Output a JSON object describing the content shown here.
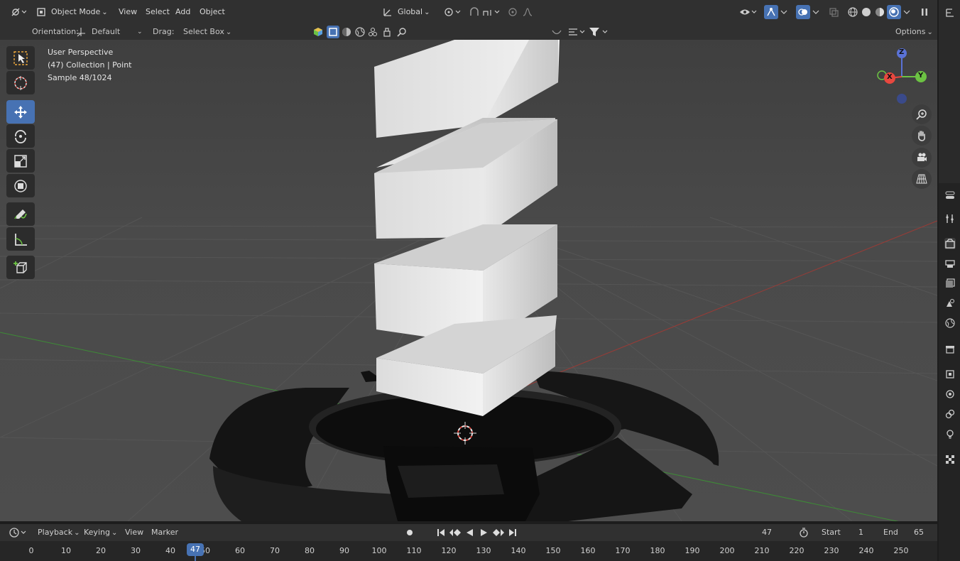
{
  "header": {
    "mode": "Object Mode",
    "menus": [
      "View",
      "Select",
      "Add",
      "Object"
    ],
    "transform_orientation": "Global"
  },
  "tool_header": {
    "orientation_label": "Orientation:",
    "orientation_value": "Default",
    "drag_label": "Drag:",
    "drag_value": "Select Box",
    "options_label": "Options"
  },
  "viewport": {
    "info_line1": "User Perspective",
    "info_line2": "(47) Collection | Point",
    "info_line3": "Sample 48/1024",
    "gizmo": {
      "x": "X",
      "y": "Y",
      "z": "Z"
    }
  },
  "timeline": {
    "menus": [
      "Playback",
      "Keying",
      "View",
      "Marker"
    ],
    "current_frame": "47",
    "start_label": "Start",
    "start_value": "1",
    "end_label": "End",
    "end_value": "65",
    "ruler_ticks": [
      "0",
      "10",
      "20",
      "30",
      "40",
      "50",
      "60",
      "70",
      "80",
      "90",
      "100",
      "110",
      "120",
      "130",
      "140",
      "150",
      "160",
      "170",
      "180",
      "190",
      "200",
      "210",
      "220",
      "230",
      "240",
      "250"
    ],
    "playhead_label": "47"
  },
  "colors": {
    "accent": "#4772b3",
    "axis_x": "#e8483f",
    "axis_y": "#6cc243",
    "axis_z": "#5a72d6"
  }
}
